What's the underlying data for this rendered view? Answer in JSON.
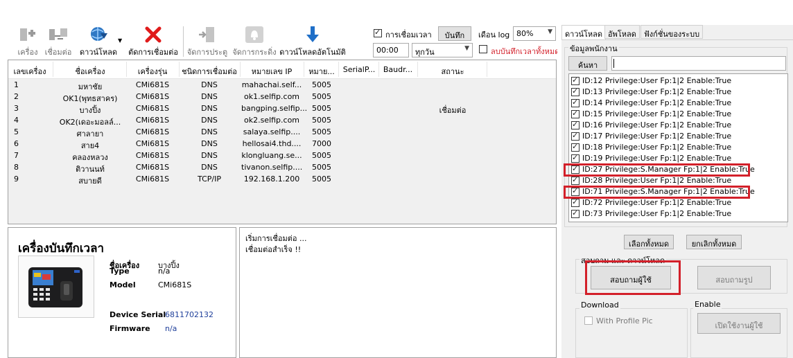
{
  "toolbar": {
    "buttons": [
      {
        "label": "เครื่อง",
        "icon": "machine-icon"
      },
      {
        "label": "เชื่อมต่อ",
        "icon": "connect-icon"
      },
      {
        "label": "ดาวน์โหลด",
        "icon": "download-globe-icon"
      },
      {
        "label": "ตัดการเชื่อมต่อ",
        "icon": "disconnect-icon"
      },
      {
        "label": "จัดการประตู",
        "icon": "door-icon"
      },
      {
        "label": "จัดการกระดิ่ง",
        "icon": "bell-icon"
      },
      {
        "label": "ดาวน์โหลดอัตโนมัติ",
        "icon": "auto-download-icon"
      }
    ],
    "time_sync_label": "การเชื่อมเวลา",
    "save_label": "บันทึก",
    "log_month_label": "เดือน log",
    "log_percent": "80%",
    "time_value": "00:00",
    "day_value": "ทุกวัน",
    "clear_log_label": "ลบบันทึกเวลาทั้งหมด"
  },
  "devices": {
    "columns": [
      "เลขเครื่อง",
      "ชื่อเครื่อง",
      "เครื่องรุ่น",
      "ชนิดการเชื่อมต่อ",
      "หมายเลข IP",
      "หมาย...",
      "SerialP...",
      "Baudr...",
      "สถานะ"
    ],
    "rows": [
      [
        "1",
        "มหาชัย",
        "CMi681S",
        "DNS",
        "mahachai.self...",
        "5005",
        "",
        "",
        ""
      ],
      [
        "2",
        "OK1(พุทธสาคร)",
        "CMi681S",
        "DNS",
        "ok1.selfip.com",
        "5005",
        "",
        "",
        ""
      ],
      [
        "3",
        "บางปิ้ง",
        "CMi681S",
        "DNS",
        "bangping.selfip...",
        "5005",
        "",
        "",
        "เชื่อมต่อ"
      ],
      [
        "4",
        "OK2(เดอะมอลล์...",
        "CMi681S",
        "DNS",
        "ok2.selfip.com",
        "5005",
        "",
        "",
        ""
      ],
      [
        "5",
        "ศาลายา",
        "CMi681S",
        "DNS",
        "salaya.selfip....",
        "5005",
        "",
        "",
        ""
      ],
      [
        "6",
        "สาย4",
        "CMi681S",
        "DNS",
        "hellosai4.thd....",
        "7000",
        "",
        "",
        ""
      ],
      [
        "7",
        "คลองหลวง",
        "CMi681S",
        "DNS",
        "klongluang.se...",
        "5005",
        "",
        "",
        ""
      ],
      [
        "8",
        "ติวานนท์",
        "CMi681S",
        "DNS",
        "tivanon.selfip....",
        "5005",
        "",
        "",
        ""
      ],
      [
        "9",
        "สบายดี",
        "CMi681S",
        "TCP/IP",
        "192.168.1.200",
        "5005",
        "",
        "",
        ""
      ]
    ]
  },
  "info": {
    "title": "เครื่องบันทึกเวลา",
    "name_label": "ชื่อเครื่อง",
    "name_value": "บางปิ้ง",
    "type_label": "Type",
    "type_value": "n/a",
    "model_label": "Model",
    "model_value": "CMi681S",
    "serial_label": "Device Serial",
    "serial_value": "6811702132",
    "firmware_label": "Firmware",
    "firmware_value": "n/a"
  },
  "log": {
    "lines": [
      "เริ่มการเชื่อมต่อ ...",
      "เชื่อมต่อสำเร็จ !!"
    ]
  },
  "right": {
    "tabs": [
      "ดาวน์โหลด",
      "อัพโหลด",
      "ฟังก์ชั่นของระบบ"
    ],
    "group_label": "ข้อมูลพนักงาน",
    "search_label": "ค้นหา",
    "search_value": "",
    "employees": [
      "ID:12 Privilege:User Fp:1|2 Enable:True",
      "ID:13 Privilege:User Fp:1|2 Enable:True",
      "ID:14 Privilege:User Fp:1|2 Enable:True",
      "ID:15 Privilege:User Fp:1|2 Enable:True",
      "ID:16 Privilege:User Fp:1|2 Enable:True",
      "ID:17 Privilege:User Fp:1|2 Enable:True",
      "ID:18 Privilege:User Fp:1|2 Enable:True",
      "ID:19 Privilege:User Fp:1|2 Enable:True",
      "ID:27 Privilege:S.Manager Fp:1|2 Enable:True",
      "ID:28 Privilege:User Fp:1|2 Enable:True",
      "ID:71 Privilege:S.Manager Fp:1|2 Enable:True",
      "ID:72 Privilege:User Fp:1|2 Enable:True",
      "ID:73 Privilege:User Fp:1|2 Enable:True"
    ],
    "select_all_label": "เลือกทั้งหมด",
    "deselect_all_label": "ยกเลิกทั้งหมด",
    "query_group_label": "สอบถาม และ ดาวน์โหลด",
    "query_user_label": "สอบถามผู้ใช้",
    "query_photo_label": "สอบถามรูป",
    "download_group_label": "Download",
    "profile_pic_label": "With Profile Pic",
    "enable_group_label": "Enable",
    "enable_user_label": "เปิดใช้งานผู้ใช้"
  },
  "colors": {
    "highlight_red": "#d3202a",
    "link_blue": "#1f3f9a"
  }
}
